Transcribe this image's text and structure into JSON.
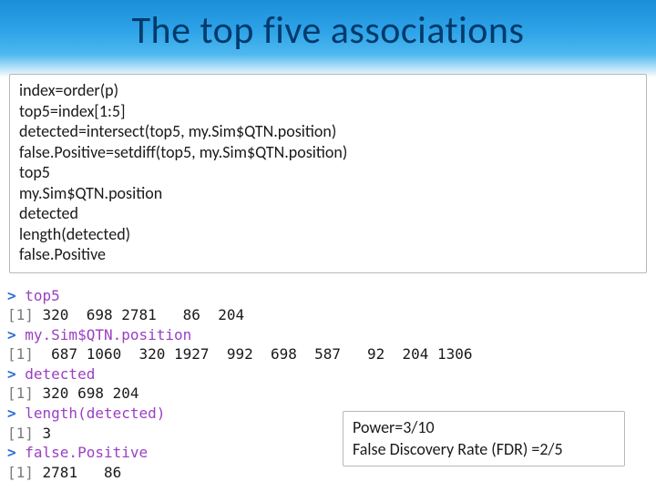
{
  "title": "The top five associations",
  "code_lines": [
    "index=order(p)",
    "top5=index[1:5]",
    "detected=intersect(top5, my.Sim$QTN.position)",
    "false.Positive=setdiff(top5, my.Sim$QTN.position)",
    "top5",
    "my.Sim$QTN.position",
    "detected",
    "length(detected)",
    "false.Positive"
  ],
  "console": {
    "entries": [
      {
        "cmd": "top5",
        "output": {
          "idx": "[1]",
          "vals": " 320  698 2781   86  204"
        }
      },
      {
        "cmd": "my.Sim$QTN.position",
        "output": {
          "idx": "[1]",
          "vals": "  687 1060  320 1927  992  698  587   92  204 1306"
        }
      },
      {
        "cmd": "detected",
        "output": {
          "idx": "[1]",
          "vals": " 320 698 204"
        }
      },
      {
        "cmd": "length(detected)",
        "output": {
          "idx": "[1]",
          "vals": " 3"
        }
      },
      {
        "cmd": "false.Positive",
        "output": {
          "idx": "[1]",
          "vals": " 2781   86"
        }
      }
    ]
  },
  "summary": {
    "line1": "Power=3/10",
    "line2": "False Discovery Rate (FDR) =2/5"
  },
  "chart_data": {
    "type": "table",
    "title": "R console outputs for top five associations",
    "series": [
      {
        "name": "top5",
        "values": [
          320,
          698,
          2781,
          86,
          204
        ]
      },
      {
        "name": "my.Sim$QTN.position",
        "values": [
          687,
          1060,
          320,
          1927,
          992,
          698,
          587,
          92,
          204,
          1306
        ]
      },
      {
        "name": "detected",
        "values": [
          320,
          698,
          204
        ]
      },
      {
        "name": "length(detected)",
        "values": [
          3
        ]
      },
      {
        "name": "false.Positive",
        "values": [
          2781,
          86
        ]
      }
    ],
    "summary": {
      "Power": "3/10",
      "FDR": "2/5"
    }
  }
}
